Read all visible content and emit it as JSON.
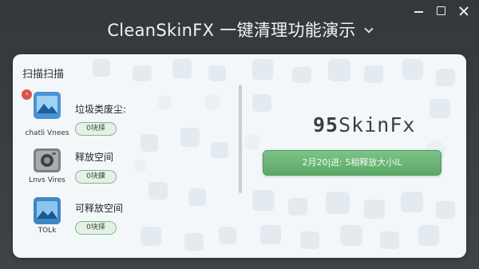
{
  "window": {
    "title": "CleanSkinFX 一键清理功能演示",
    "controls": {
      "minimize": "minimize",
      "maximize": "maximize",
      "close": "close"
    }
  },
  "panel": {
    "section_title": "扫描扫描",
    "collapse_icon": "‹",
    "items": [
      {
        "icon": "landscape-picture-icon",
        "caption": "chatli Vnees",
        "title": "垃圾类废尘:",
        "status": "0块择",
        "color": "#4a93d6"
      },
      {
        "icon": "camera-icon",
        "caption": "Lnvs Vires",
        "title": "释放空间",
        "status": "0块鍊",
        "color": "#7b8287"
      },
      {
        "icon": "landscape-picture-icon",
        "caption": "TOLk",
        "title": "可释放空间",
        "status": "0块择",
        "color": "#3f86c7"
      }
    ]
  },
  "brand": {
    "mark": "95",
    "text": "SkinFx"
  },
  "action": {
    "label": "2月20|进: 5相释放大小lL",
    "color": "#6db878"
  }
}
